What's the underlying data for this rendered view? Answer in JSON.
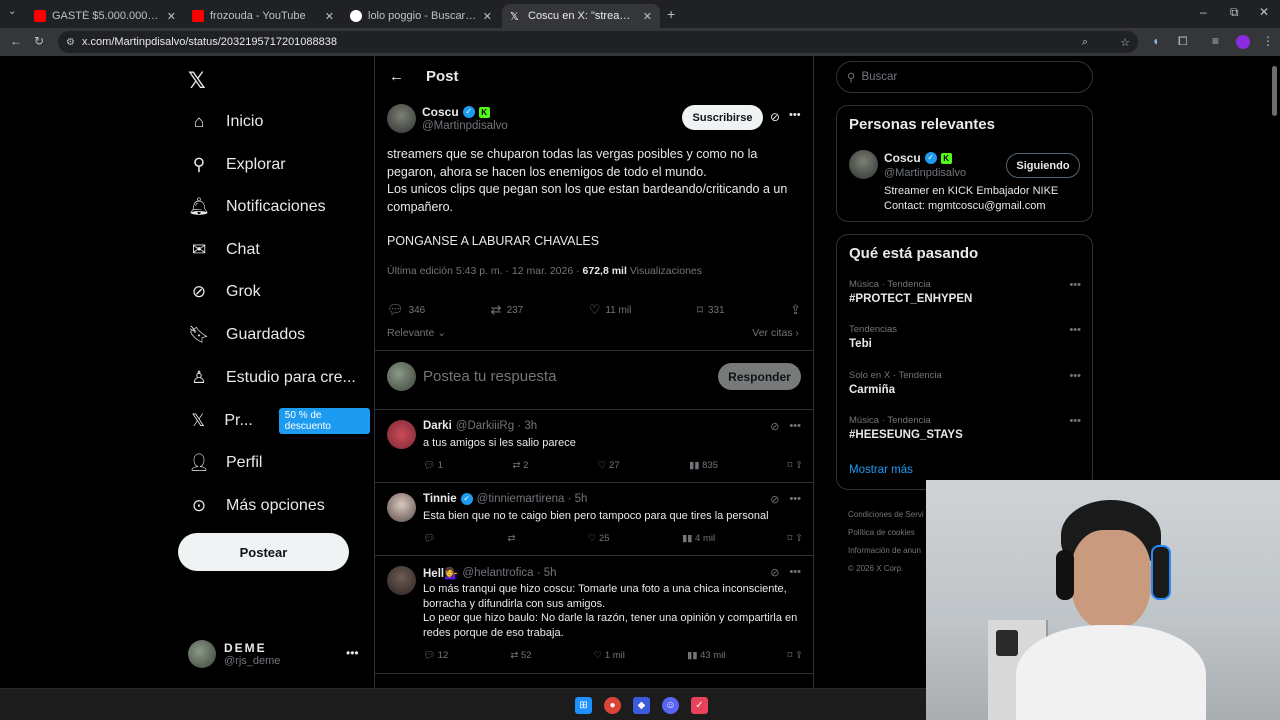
{
  "browser": {
    "tabs": [
      {
        "title": "GASTÉ $5.000.000 EN EL SUPER",
        "active": false
      },
      {
        "title": "frozouda - YouTube",
        "active": false
      },
      {
        "title": "lolo poggio - Buscar con Google",
        "active": false
      },
      {
        "title": "Coscu en X: \"streamers que se c",
        "active": true
      }
    ],
    "url": "x.com/Martinpdisalvo/status/2032195717201088838"
  },
  "nav": {
    "items": [
      {
        "label": "Inicio",
        "icon": "home-icon"
      },
      {
        "label": "Explorar",
        "icon": "search-icon"
      },
      {
        "label": "Notificaciones",
        "icon": "bell-icon"
      },
      {
        "label": "Chat",
        "icon": "mail-icon"
      },
      {
        "label": "Grok",
        "icon": "grok-icon"
      },
      {
        "label": "Guardados",
        "icon": "bookmark-icon"
      },
      {
        "label": "Estudio para cre...",
        "icon": "studio-icon"
      },
      {
        "label": "Pr...",
        "icon": "x-premium-icon"
      },
      {
        "label": "Perfil",
        "icon": "person-icon"
      },
      {
        "label": "Más opciones",
        "icon": "more-circle-icon"
      }
    ],
    "promo_badge": "50 % de descuento",
    "post_button": "Postear",
    "account": {
      "name": "DEME",
      "handle": "@rjs_deme"
    }
  },
  "post": {
    "header": "Post",
    "author": {
      "name": "Coscu",
      "handle": "@Martinpdisalvo"
    },
    "subscribe_label": "Suscribirse",
    "text_lines": [
      "streamers que se chuparon todas las vergas posibles y como no la pegaron, ahora se hacen los enemigos de todo el mundo.",
      "Los unicos clips que pegan son los que estan bardeando/criticando a un compañero.",
      "",
      "PONGANSE A LABURAR CHAVALES"
    ],
    "meta_time": "Última edición 5:43 p. m. · 12 mar. 2026 ·",
    "views_count": "672,8 mil",
    "views_label": "Visualizaciones",
    "stats": {
      "replies": "346",
      "reposts": "237",
      "likes": "11 mil",
      "bookmarks": "331"
    },
    "sort_label": "Relevante",
    "quotes_label": "Ver citas",
    "reply_placeholder": "Postea tu respuesta",
    "reply_button": "Responder"
  },
  "replies": [
    {
      "name": "Darki",
      "handle": "@DarkiiiRg · 3h",
      "verified": false,
      "text": "a tus amigos si les salio parece",
      "replies": "1",
      "reposts": "2",
      "likes": "27",
      "views": "835"
    },
    {
      "name": "Tinnie",
      "handle": "@tinniemartirena · 5h",
      "verified": true,
      "text": "Esta bien que no te caigo bien pero tampoco para que tires la personal",
      "replies": "",
      "reposts": "",
      "likes": "25",
      "views": "4 mil"
    },
    {
      "name": "Hell💁‍♀️",
      "handle": "@helantrofica · 5h",
      "verified": false,
      "text": "Lo más tranqui que hizo coscu: Tomarle una foto a una chica inconsciente, borracha y difundirla con sus amigos.\nLo peor que hizo baulo: No darle la razón, tener una opinión y compartirla en redes porque de eso trabaja.",
      "replies": "12",
      "reposts": "52",
      "likes": "1 mil",
      "views": "43 mil"
    }
  ],
  "sidebar": {
    "search_placeholder": "Buscar",
    "relevant_title": "Personas relevantes",
    "relevant_user": {
      "name": "Coscu",
      "handle": "@Martinpdisalvo",
      "bio": "Streamer en KICK Embajador NIKE Contact: mgmtcoscu@gmail.com",
      "follow_label": "Siguiendo"
    },
    "trending_title": "Qué está pasando",
    "trends": [
      {
        "category": "Música · Tendencia",
        "name": "#PROTECT_ENHYPEN"
      },
      {
        "category": "Tendencias",
        "name": "Tebi"
      },
      {
        "category": "Solo en X · Tendencia",
        "name": "Carmiña"
      },
      {
        "category": "Música · Tendencia",
        "name": "#HEESEUNG_STAYS"
      }
    ],
    "show_more": "Mostrar más",
    "footer_links": [
      "Condiciones de Servi",
      "Política de cookies",
      "Información de anun",
      "© 2026 X Corp."
    ]
  },
  "colors": {
    "accent": "#1d9bf0",
    "background": "#000000",
    "border": "#2f3336",
    "muted": "#71767b"
  }
}
